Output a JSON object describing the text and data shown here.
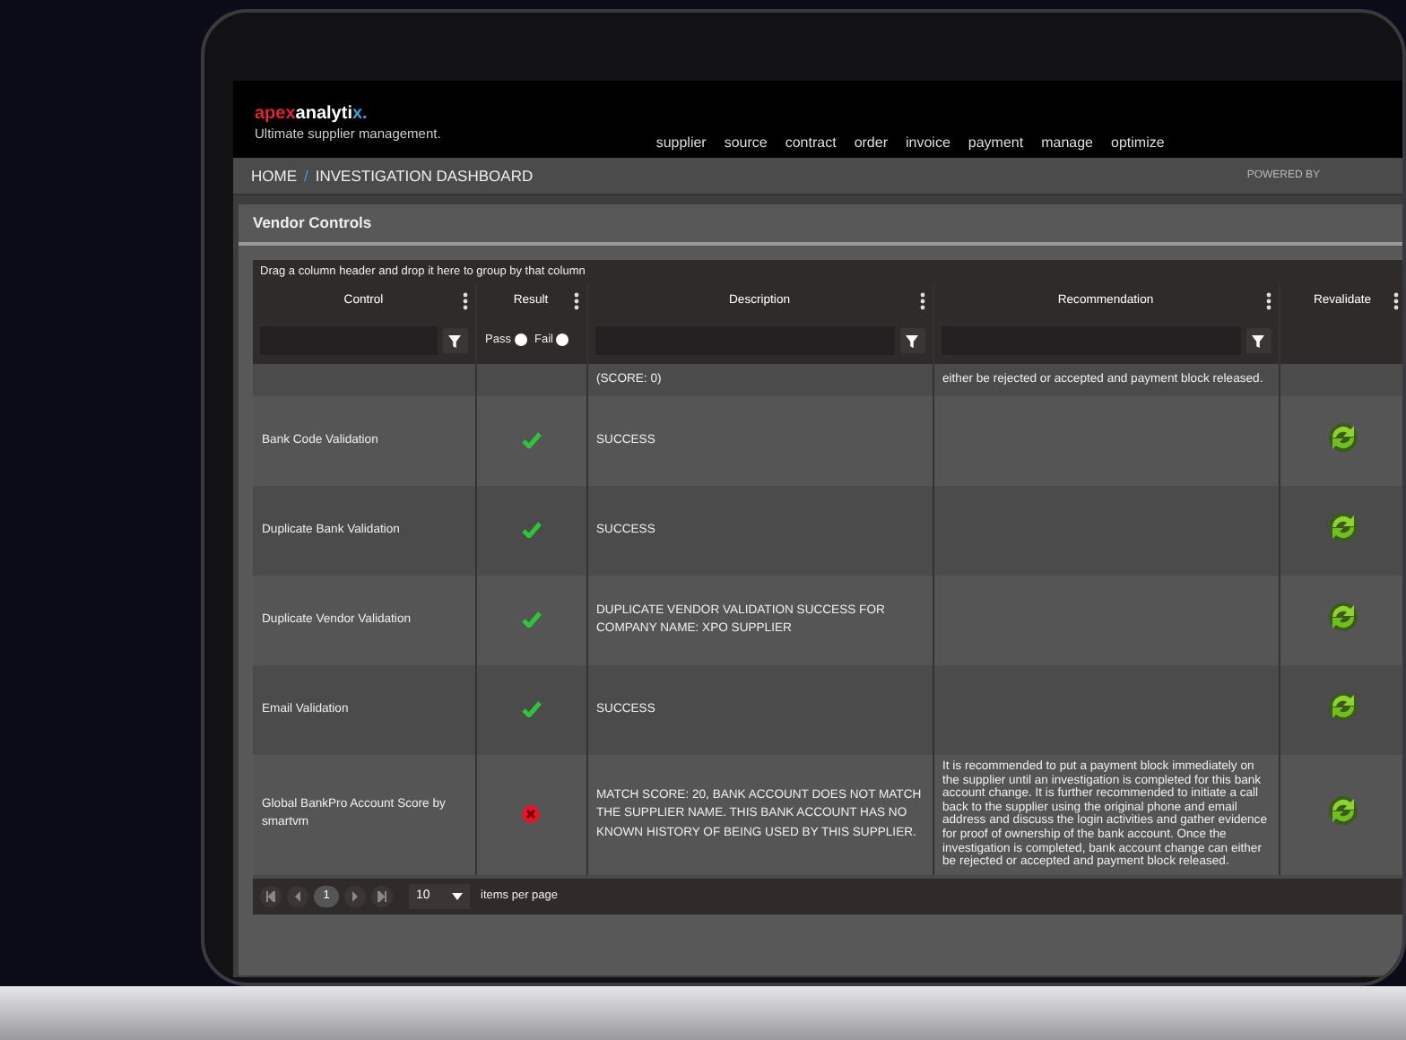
{
  "logo": {
    "parts": [
      {
        "text": "apex",
        "color": "#e0262f"
      },
      {
        "text": "analyti",
        "color": "#ffffff"
      },
      {
        "text": "x",
        "color": "#3aa0d8"
      },
      {
        "text": ".",
        "color": "#3aa0d8"
      }
    ],
    "tagline": "Ultimate supplier management."
  },
  "nav": [
    "supplier",
    "source",
    "contract",
    "order",
    "invoice",
    "payment",
    "manage",
    "optimize"
  ],
  "breadcrumb": {
    "home": "HOME",
    "separator": "/",
    "current": "INVESTIGATION DASHBOARD",
    "powered_by": "POWERED BY"
  },
  "panel": {
    "title": "Vendor Controls"
  },
  "grid": {
    "group_hint": "Drag a column header and drop it here to group by that column",
    "columns": [
      "Control",
      "Result",
      "Description",
      "Recommendation",
      "Revalidate"
    ],
    "result_filter": [
      {
        "label": "Pass",
        "checked": false
      },
      {
        "label": "Fail",
        "checked": false
      }
    ],
    "partial_row": {
      "description": "(SCORE: 0)",
      "recommendation": "either be rejected or accepted and payment block released."
    },
    "rows": [
      {
        "control": "Bank Code Validation",
        "kind": "pass",
        "description": "SUCCESS",
        "recommendation": ""
      },
      {
        "control": "Duplicate Bank Validation",
        "kind": "pass",
        "description": "SUCCESS",
        "recommendation": ""
      },
      {
        "control": "Duplicate Vendor Validation",
        "kind": "pass",
        "description": "DUPLICATE VENDOR VALIDATION SUCCESS FOR COMPANY NAME: XPO SUPPLIER",
        "recommendation": ""
      },
      {
        "control": "Email Validation",
        "kind": "pass",
        "description": "SUCCESS",
        "recommendation": ""
      },
      {
        "control": "Global BankPro Account Score by smartvm",
        "kind": "fail",
        "description": "MATCH SCORE: 20, BANK ACCOUNT DOES NOT MATCH THE SUPPLIER NAME. THIS BANK ACCOUNT HAS NO KNOWN HISTORY OF BEING USED BY THIS SUPPLIER.",
        "recommendation": "It is recommended to put a payment block immediately on the supplier until an investigation is completed for this bank account change. It is further recommended to initiate a call back to the supplier using the original phone and email address and discuss the login activities and gather evidence for proof of ownership of the bank account. Once the investigation is completed, bank account change can either be rejected or accepted and payment block released."
      }
    ],
    "pager": {
      "pages": [
        {
          "label": "1",
          "selected": true
        }
      ],
      "page_size": "10",
      "page_size_label": "items per page"
    }
  }
}
